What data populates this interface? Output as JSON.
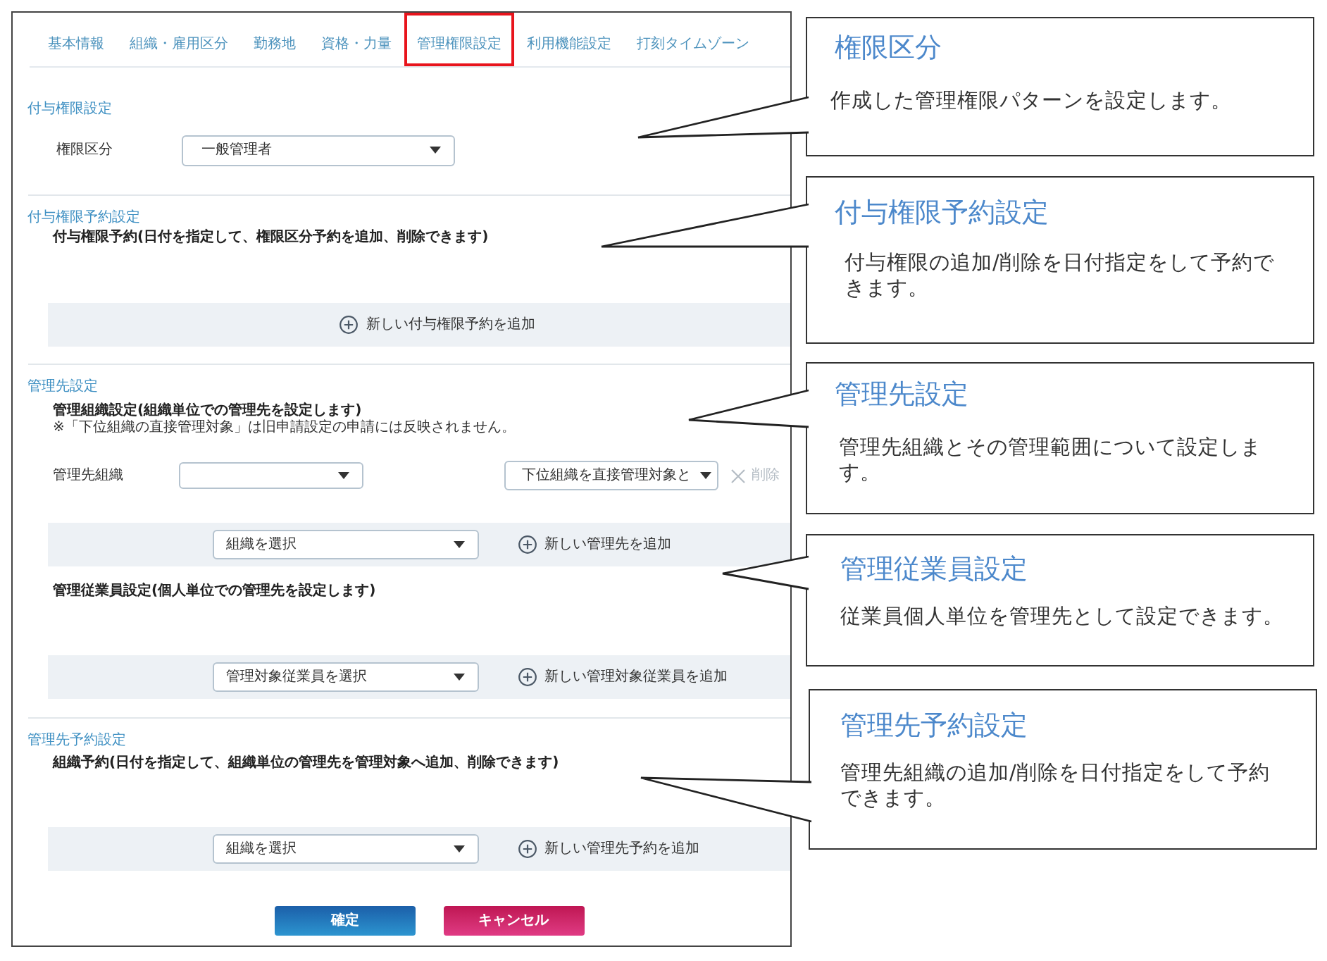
{
  "tabs": [
    {
      "label": "基本情報",
      "selected": false
    },
    {
      "label": "組織・雇用区分",
      "selected": false
    },
    {
      "label": "勤務地",
      "selected": false
    },
    {
      "label": "資格・力量",
      "selected": false
    },
    {
      "label": "管理権限設定",
      "selected": true
    },
    {
      "label": "利用機能設定",
      "selected": false
    },
    {
      "label": "打刻タイムゾーン",
      "selected": false
    }
  ],
  "grant_settings": {
    "heading": "付与権限設定",
    "field": {
      "label": "権限区分",
      "value": "一般管理者"
    }
  },
  "grant_reservation": {
    "heading": "付与権限予約設定",
    "description": "付与権限予約(日付を指定して、権限区分予約を追加、削除できます)",
    "add_label": "新しい付与権限予約を追加"
  },
  "managed_settings": {
    "heading": "管理先設定",
    "org_description": "管理組織設定(組織単位での管理先を設定します)",
    "note": "※「下位組織の直接管理対象」は旧申請設定の申請には反映されません。",
    "org_row": {
      "label": "管理先組織",
      "scope": "下位組織を直接管理対象と",
      "delete": {
        "label": "削除",
        "disabled": true
      }
    },
    "org_add": {
      "select": "組織を選択",
      "add_label": "新しい管理先を追加"
    },
    "employee_description": "管理従業員設定(個人単位での管理先を設定します)",
    "employee_add": {
      "select": "管理対象従業員を選択",
      "add_label": "新しい管理対象従業員を追加"
    }
  },
  "managed_reservation": {
    "heading": "管理先予約設定",
    "description": "組織予約(日付を指定して、組織単位の管理先を管理対象へ追加、削除できます)",
    "add": {
      "select": "組織を選択",
      "add_label": "新しい管理先予約を追加"
    }
  },
  "buttons": [
    {
      "label": "確定",
      "kind": "primary"
    },
    {
      "label": "キャンセル",
      "kind": "danger"
    }
  ],
  "callouts": [
    {
      "title": "権限区分",
      "text": "作成した管理権限パターンを設定します。"
    },
    {
      "title": "付与権限予約設定",
      "text": "付与権限の追加/削除を日付指定をして予約できます。"
    },
    {
      "title": "管理先設定",
      "text": "管理先組織とその管理範囲について設定します。"
    },
    {
      "title": "管理従業員設定",
      "text": "従業員個人単位を管理先として設定できます。"
    },
    {
      "title": "管理先予約設定",
      "text": "管理先組織の追加/削除を日付指定をして予約できます。"
    }
  ]
}
